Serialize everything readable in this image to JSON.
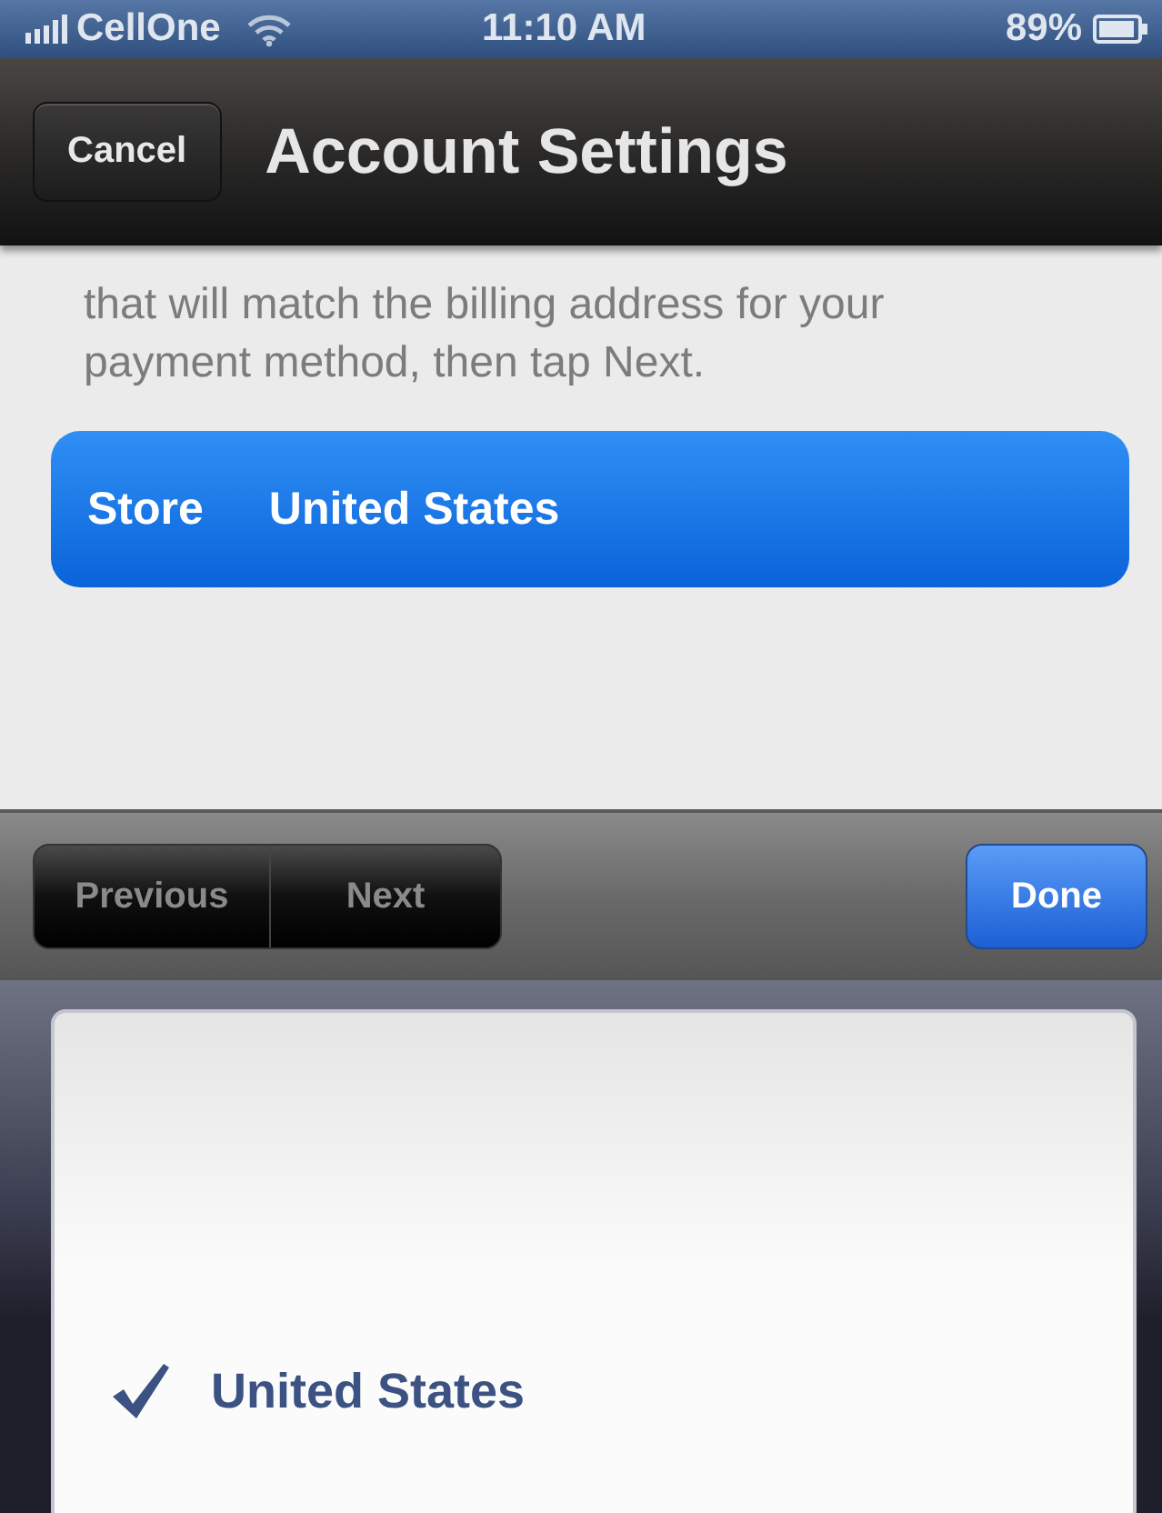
{
  "status_bar": {
    "carrier": "CellOne",
    "time": "11:10 AM",
    "battery": "89%"
  },
  "nav_bar": {
    "cancel": "Cancel",
    "title": "Account Settings"
  },
  "intro_lines": [
    "that will match the billing address for your",
    "payment method, then tap Next."
  ],
  "store_cell": {
    "label": "Store",
    "value": "United States"
  },
  "toolbar": {
    "previous": {
      "label": "Previous",
      "disabled": true
    },
    "next": {
      "label": "Next",
      "disabled": true
    },
    "done": "Done"
  },
  "picker": {
    "items": [
      {
        "label": "United States",
        "selected": true
      }
    ]
  }
}
